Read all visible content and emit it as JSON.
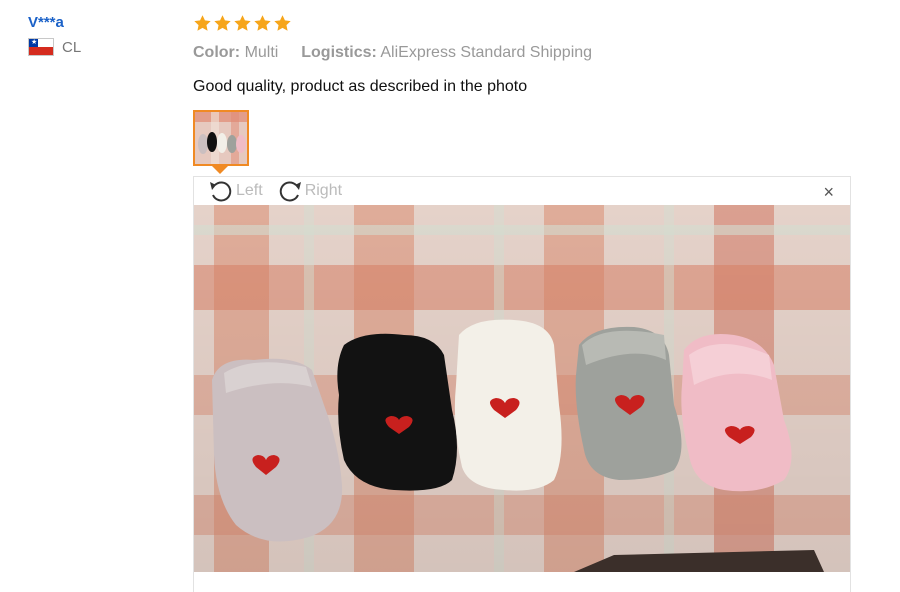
{
  "user": {
    "name": "V***a",
    "country_code": "CL"
  },
  "review": {
    "rating": 5,
    "stars": [
      "star",
      "star",
      "star",
      "star",
      "star"
    ],
    "star_color": "#f6a51a",
    "color_key": "Color:",
    "color_value": "Multi",
    "logistics_key": "Logistics:",
    "logistics_value": "AliExpress Standard Shipping",
    "text": "Good quality, product as described in the photo"
  },
  "viewer": {
    "rotate_left_label": "Left",
    "rotate_right_label": "Right",
    "close_label": "×",
    "photo_subject": "five ankle socks with red hearts on a checkered cloth",
    "sock_colors": [
      "#c9bfc0",
      "#111111",
      "#f2efe8",
      "#9ea19c",
      "#f0bcc6"
    ]
  },
  "colors": {
    "accent": "#f08a24",
    "link": "#1a61c8"
  }
}
